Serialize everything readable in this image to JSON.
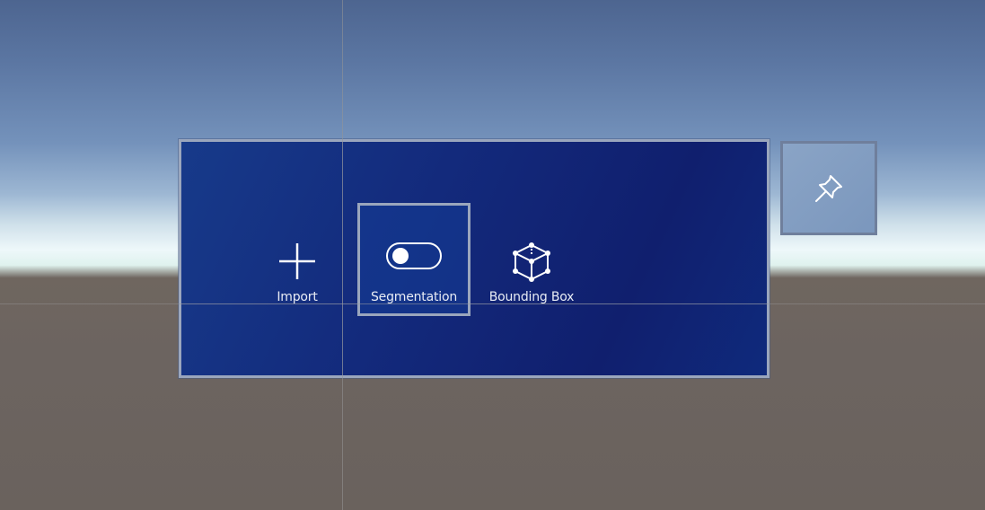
{
  "toolbar": {
    "buttons": [
      {
        "id": "import",
        "label": "Import",
        "icon": "plus-icon",
        "selected": false
      },
      {
        "id": "segmentation",
        "label": "Segmentation",
        "icon": "toggle-icon",
        "selected": true
      },
      {
        "id": "bounding-box",
        "label": "Bounding Box",
        "icon": "cube-icon",
        "selected": false
      }
    ],
    "pin": {
      "icon": "pin-icon"
    }
  },
  "colors": {
    "panel_background": "#132a7c",
    "panel_border": "#9aa6bd",
    "label_text": "#e8ecf4",
    "ground": "#6c6460",
    "sky_top": "#4d6590"
  }
}
